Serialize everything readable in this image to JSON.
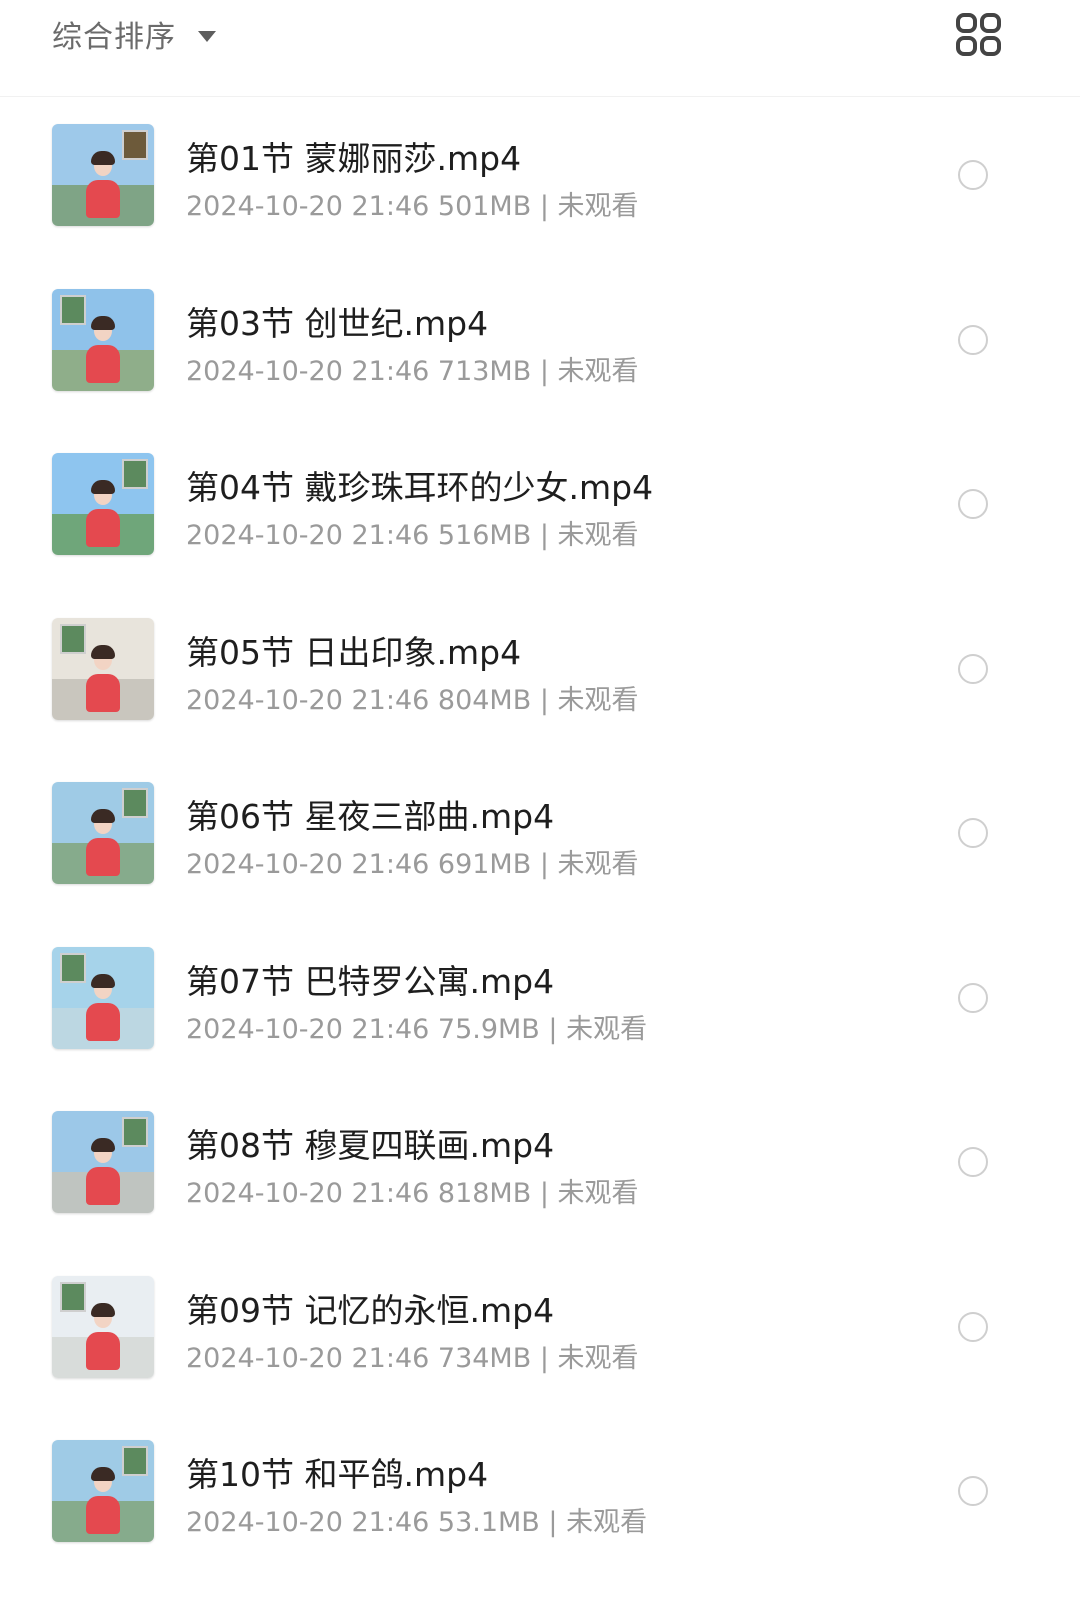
{
  "toolbar": {
    "sort_label": "综合排序",
    "sort_icon": "caret-down-icon",
    "view_icon": "grid-view-icon"
  },
  "colors": {
    "title": "#1e1e1e",
    "meta": "#9a9a9a",
    "radio_border": "#cfcfcf",
    "dress_red": "#e4494f"
  },
  "files": [
    {
      "title": "第01节 蒙娜丽莎.mp4",
      "meta": "2024-10-20 21:46  501MB | 未观看",
      "selected": false
    },
    {
      "title": "第03节 创世纪.mp4",
      "meta": "2024-10-20 21:46  713MB | 未观看",
      "selected": false
    },
    {
      "title": "第04节 戴珍珠耳环的少女.mp4",
      "meta": "2024-10-20 21:46  516MB | 未观看",
      "selected": false
    },
    {
      "title": "第05节 日出印象.mp4",
      "meta": "2024-10-20 21:46  804MB | 未观看",
      "selected": false
    },
    {
      "title": "第06节 星夜三部曲.mp4",
      "meta": "2024-10-20 21:46  691MB | 未观看",
      "selected": false
    },
    {
      "title": "第07节 巴特罗公寓.mp4",
      "meta": "2024-10-20 21:46  75.9MB | 未观看",
      "selected": false
    },
    {
      "title": "第08节 穆夏四联画.mp4",
      "meta": "2024-10-20 21:46  818MB | 未观看",
      "selected": false
    },
    {
      "title": "第09节 记忆的永恒.mp4",
      "meta": "2024-10-20 21:46  734MB | 未观看",
      "selected": false
    },
    {
      "title": "第10节 和平鸽.mp4",
      "meta": "2024-10-20 21:46  53.1MB | 未观看",
      "selected": false
    }
  ]
}
